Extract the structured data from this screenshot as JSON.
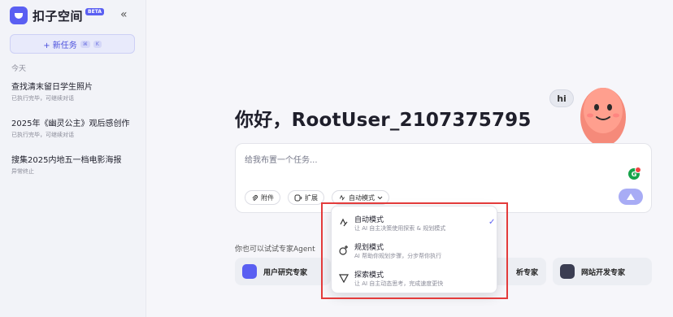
{
  "app": {
    "name": "扣子空间",
    "badge": "BETA",
    "collapse_icon": "«"
  },
  "sidebar": {
    "new_task": {
      "label": "+ 新任务",
      "shortcut_1": "⌘",
      "shortcut_2": "K"
    },
    "section": "今天",
    "history": [
      {
        "title": "查找清末留日学生照片",
        "status": "已执行完毕，可继续对话"
      },
      {
        "title": "2025年《幽灵公主》观后感创作",
        "status": "已执行完毕，可继续对话"
      },
      {
        "title": "搜集2025内地五一档电影海报",
        "status": "异常终止"
      }
    ]
  },
  "main": {
    "greeting": "你好，RootUser_2107375795",
    "mascot_bubble": "hi",
    "composer": {
      "placeholder": "给我布置一个任务...",
      "attach": "附件",
      "extend": "扩展",
      "mode": "自动模式",
      "grammarly": "G"
    },
    "experts": {
      "label": "你也可以试试专家Agent",
      "cards": [
        {
          "label": "用户研究专家",
          "color": "#5a5ff2"
        },
        {
          "label": "析专家",
          "color": "#c9cbd4"
        },
        {
          "label": "网站开发专家",
          "color": "#3b3d52"
        }
      ]
    }
  },
  "dropdown": {
    "options": [
      {
        "title": "自动模式",
        "desc": "让 AI 自主决策使用探索 & 规划模式",
        "selected": true
      },
      {
        "title": "规划模式",
        "desc": "AI 帮助你规划步骤，分步帮你执行",
        "selected": false
      },
      {
        "title": "探索模式",
        "desc": "让 AI 自主动态思考，完成速度更快",
        "selected": false
      }
    ],
    "check": "✓"
  },
  "colors": {
    "accent": "#5a5ff2",
    "highlight": "#e33b3b"
  }
}
